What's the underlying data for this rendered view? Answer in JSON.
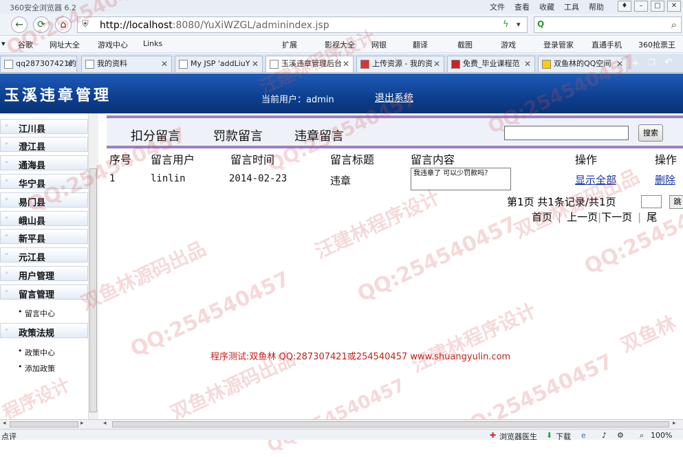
{
  "browser": {
    "title": "360安全浏览器 6.2",
    "menu": [
      "文件",
      "查看",
      "收藏",
      "工具",
      "帮助"
    ],
    "url_host": "http://localhost",
    "url_rest": ":8080/YuXiWZGL/adminindex.jsp",
    "bookmarks": [
      "谷歌",
      "网址大全",
      "游戏中心",
      "Links",
      "扩展",
      "影视大全",
      "网银",
      "翻译",
      "截图",
      "游戏",
      "登录管家",
      "直通手机",
      "360抢票王"
    ],
    "tabs": [
      "qq287307421的",
      "我的资料",
      "My JSP 'addLiuY",
      "玉溪违章管理后台",
      "上传资源 - 我的资",
      "免费_毕业课程范",
      "双鱼林的QQ空间"
    ]
  },
  "header": {
    "logo": "玉溪违章管理",
    "current_user": "当前用户：admin",
    "logout": "退出系统"
  },
  "sidebar": {
    "items": [
      "江川县",
      "澄江县",
      "通海县",
      "华宁县",
      "易门县",
      "峨山县",
      "新平县",
      "元江县",
      "用户管理",
      "留言管理"
    ],
    "sub_liuyan": [
      "留言中心"
    ],
    "policy": "政策法规",
    "sub_policy": [
      "政策中心",
      "添加政策"
    ]
  },
  "subnav": {
    "tabs": [
      "扣分留言",
      "罚款留言",
      "违章留言"
    ],
    "search_button": "搜索"
  },
  "table": {
    "headers": [
      "序号",
      "留言用户",
      "留言时间",
      "留言标题",
      "留言内容",
      "操作",
      "操作"
    ],
    "rows": [
      {
        "id": "1",
        "user": "linlin",
        "time": "2014-02-23",
        "title": "违章",
        "content": "我违章了 可以少罚款吗？",
        "action1": "显示全部",
        "action2": "删除"
      }
    ]
  },
  "pagination": {
    "info": "第1页 共1条记录/共1页",
    "jump": "跳",
    "first": "首页",
    "prev": "上一页",
    "next": "下一页",
    "last": "尾"
  },
  "footer": "程序测试:双鱼林 QQ:287307421或254540457 www.shuangyulin.com",
  "status": [
    "点评",
    "浏览器医生",
    "下载",
    "100%"
  ],
  "watermarks": [
    "QQ:254540457",
    "双鱼林源码出品",
    "汪建林程序设计",
    "QQ:254540457",
    "双鱼林源码出品",
    "QQ:254540457",
    "汪建林程序设计",
    "QQ:254540457",
    "双鱼林源码出品",
    "程序设计",
    "QQ:254540457",
    "双鱼林",
    "QQ:254540457"
  ],
  "colors": {
    "banner": "#0d3f8e",
    "subnav_border": "#9f7fc0",
    "footer_text": "#c0201b",
    "link": "#1133aa"
  }
}
